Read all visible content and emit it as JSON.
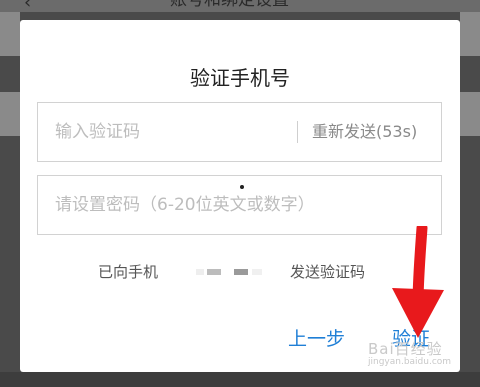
{
  "background": {
    "back_icon": "chevron-left-icon",
    "title": "账号和绑定设置"
  },
  "dialog": {
    "title": "验证手机号",
    "code_field": {
      "placeholder": "输入验证码",
      "resend_label": "重新发送(53s)"
    },
    "password_field": {
      "placeholder": "请设置密码（6-20位英文或数字）"
    },
    "sent_info": {
      "prefix": "已向手机",
      "suffix": "发送验证码"
    },
    "buttons": {
      "prev_label": "上一步",
      "verify_label": "验证"
    }
  },
  "annotation": {
    "arrow_color": "#e8191c",
    "arrow_icon": "arrow-down-icon"
  },
  "watermark": {
    "text": "Bai百经验",
    "url": "jingyan.baidu.com"
  },
  "colors": {
    "accent": "#1f7fd6",
    "overlay": "#4a4a4a",
    "dialog_bg": "#ffffff"
  }
}
